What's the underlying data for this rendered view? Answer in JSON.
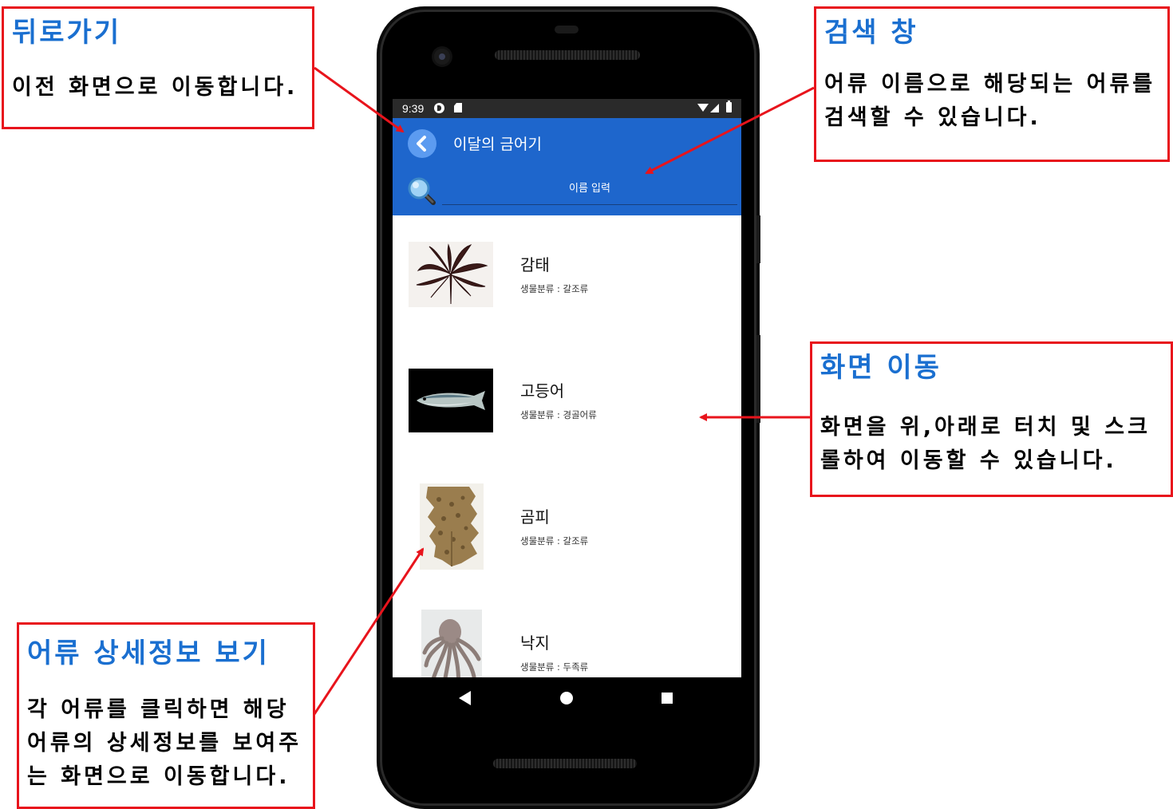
{
  "annotations": {
    "back": {
      "title": "뒤로가기",
      "body": "이전 화면으로 이동합니다."
    },
    "search": {
      "title": "검색 창",
      "body": "어류 이름으로 해당되는 어류를 검색할 수 있습니다."
    },
    "scroll": {
      "title": "화면 이동",
      "body": "화면을 위,아래로 터치 및 스크롤하여 이동할 수 있습니다."
    },
    "detail": {
      "title": "어류 상세정보 보기",
      "body": "각 어류를 클릭하면 해당 어류의 상세정보를 보여주는 화면으로 이동합니다."
    }
  },
  "status_bar": {
    "time": "9:39"
  },
  "app_bar": {
    "title": "이달의 금어기",
    "back_icon": "chevron-left-icon"
  },
  "search": {
    "icon": "search-icon",
    "placeholder": "이름 입력"
  },
  "list": {
    "items": [
      {
        "name": "감태",
        "classification": "생물분류 : 갈조류",
        "thumbnail": "seaweed-image"
      },
      {
        "name": "고등어",
        "classification": "생물분류 : 경골어류",
        "thumbnail": "mackerel-image"
      },
      {
        "name": "곰피",
        "classification": "생물분류 : 갈조류",
        "thumbnail": "kelp-image"
      },
      {
        "name": "낙지",
        "classification": "생물분류 : 두족류",
        "thumbnail": "octopus-image"
      }
    ]
  },
  "nav_bar": {
    "back_icon": "triangle-back-icon",
    "home_icon": "circle-home-icon",
    "recent_icon": "square-recents-icon"
  },
  "colors": {
    "annotation_border": "#e8141c",
    "annotation_title": "#1a6fd0",
    "app_bar": "#1e66cc",
    "arrow": "#e8141c"
  }
}
